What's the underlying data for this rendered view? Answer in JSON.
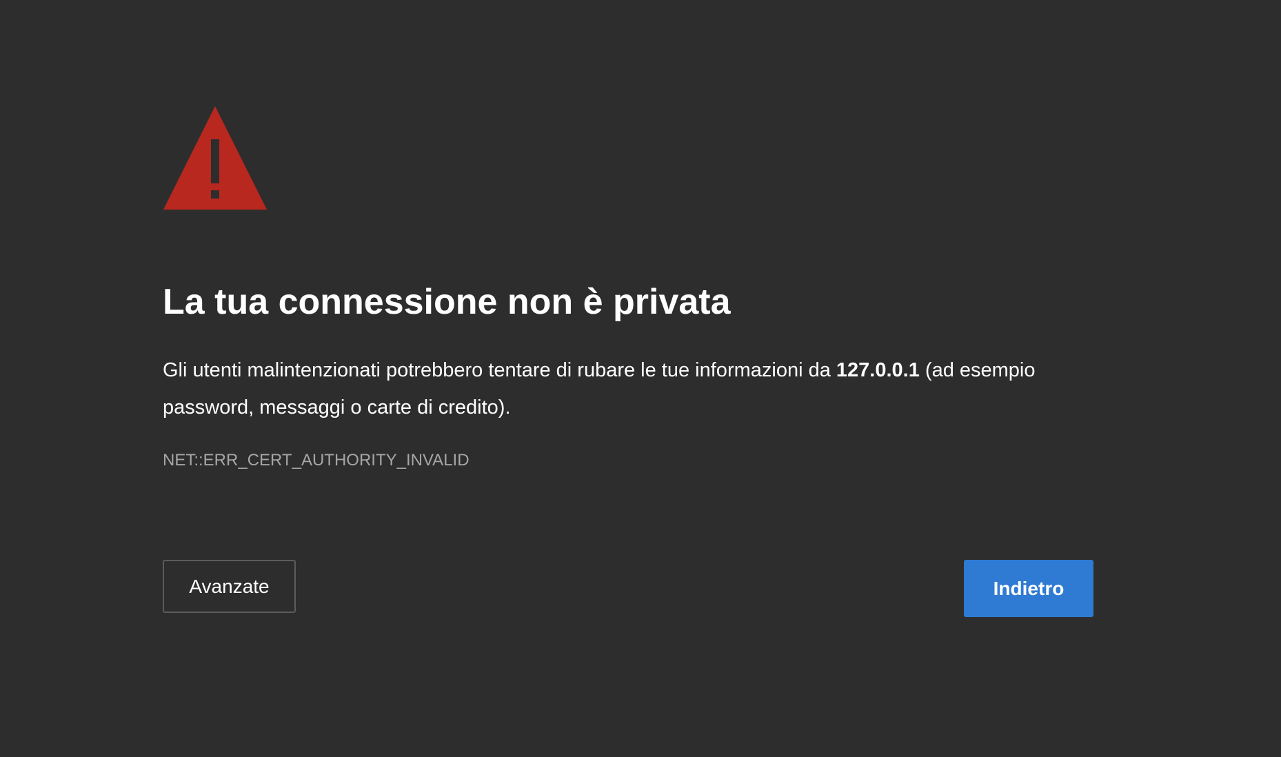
{
  "icon": {
    "name": "warning-triangle-icon",
    "color": "#b8281e",
    "mark_color": "#2d2d2d"
  },
  "title": "La tua connessione non è privata",
  "description": {
    "before": "Gli utenti malintenzionati potrebbero tentare di rubare le tue informazioni da ",
    "host": "127.0.0.1",
    "after": " (ad esempio password, messaggi o carte di credito)."
  },
  "error_code": "NET::ERR_CERT_AUTHORITY_INVALID",
  "buttons": {
    "advanced_label": "Avanzate",
    "back_label": "Indietro"
  },
  "colors": {
    "background": "#2d2d2d",
    "primary_button": "#2f7ad3",
    "error_code_text": "#a6a6a6"
  }
}
